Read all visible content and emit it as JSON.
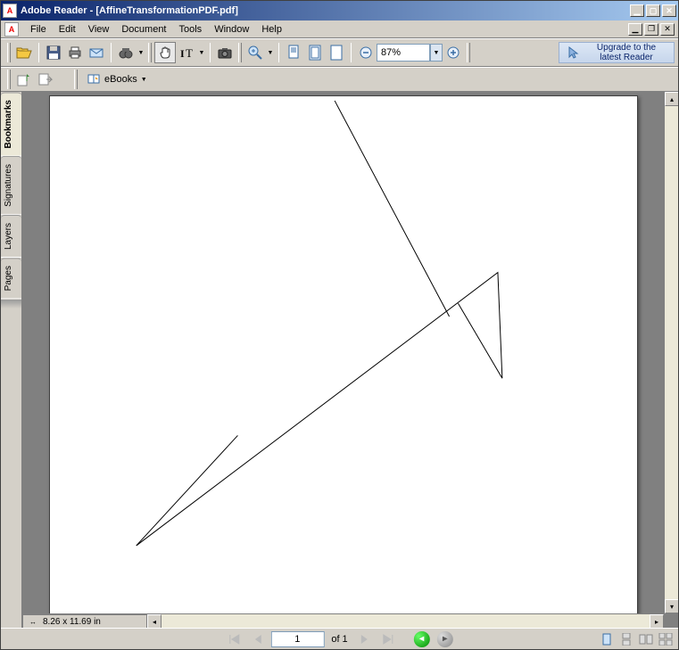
{
  "window": {
    "app_name": "Adobe Reader",
    "doc_name": "[AffineTransformationPDF.pdf]"
  },
  "menu": {
    "items": [
      "File",
      "Edit",
      "View",
      "Document",
      "Tools",
      "Window",
      "Help"
    ]
  },
  "toolbar": {
    "zoom_value": "87%",
    "upgrade_label": "Upgrade to the latest Reader",
    "ebooks_label": "eBooks"
  },
  "sidepanel": {
    "tabs": [
      "Bookmarks",
      "Signatures",
      "Layers",
      "Pages"
    ],
    "active_tab": 0
  },
  "statusbar": {
    "page_size": "8.26 x 11.69 in",
    "current_page": "1",
    "page_of_label": "of 1"
  }
}
